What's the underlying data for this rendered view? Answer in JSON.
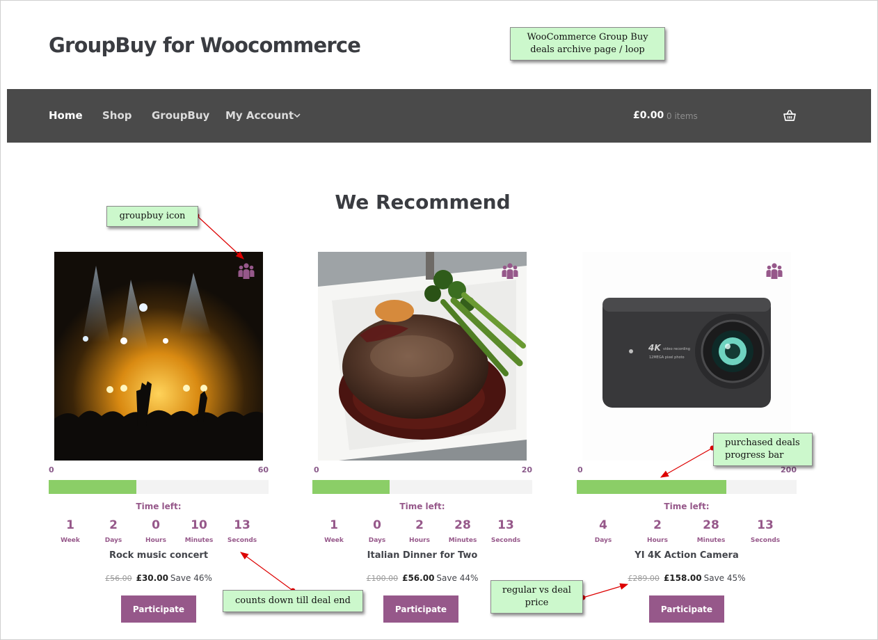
{
  "site": {
    "title": "GroupBuy for Woocommerce"
  },
  "nav": {
    "items": [
      {
        "label": "Home"
      },
      {
        "label": "Shop"
      },
      {
        "label": "GroupBuy"
      },
      {
        "label": "My Account"
      }
    ],
    "cart_total": "£0.00",
    "cart_count": "0 items"
  },
  "section_title": "We Recommend",
  "time_left_label": "Time left:",
  "participate_label": "Participate",
  "products": [
    {
      "title": "Rock music concert",
      "progress_min": "0",
      "progress_max": "60",
      "progress_fraction": 0.4,
      "countdown": [
        {
          "value": "1",
          "label": "Week"
        },
        {
          "value": "2",
          "label": "Days"
        },
        {
          "value": "0",
          "label": "Hours"
        },
        {
          "value": "10",
          "label": "Minutes"
        },
        {
          "value": "13",
          "label": "Seconds"
        }
      ],
      "regular_price": "£56.00",
      "deal_price": "£30.00",
      "save_text": "Save 46%"
    },
    {
      "title": "Italian Dinner for Two",
      "progress_min": "0",
      "progress_max": "20",
      "progress_fraction": 0.35,
      "countdown": [
        {
          "value": "1",
          "label": "Week"
        },
        {
          "value": "0",
          "label": "Days"
        },
        {
          "value": "2",
          "label": "Hours"
        },
        {
          "value": "28",
          "label": "Minutes"
        },
        {
          "value": "13",
          "label": "Seconds"
        }
      ],
      "regular_price": "£100.00",
      "deal_price": "£56.00",
      "save_text": "Save 44%"
    },
    {
      "title": "YI 4K Action Camera",
      "progress_min": "0",
      "progress_max": "200",
      "progress_fraction": 0.68,
      "countdown": [
        {
          "value": "4",
          "label": "Days"
        },
        {
          "value": "2",
          "label": "Hours"
        },
        {
          "value": "28",
          "label": "Minutes"
        },
        {
          "value": "13",
          "label": "Seconds"
        }
      ],
      "regular_price": "£289.00",
      "deal_price": "£158.00",
      "save_text": "Save 45%",
      "camera_text_1": "4K",
      "camera_text_2": "video recording",
      "camera_text_3": "12MEGA pixel photo"
    }
  ],
  "annotations": {
    "archive_line1": "WooCommerce Group Buy",
    "archive_line2": "deals archive page / loop",
    "icon": "groupbuy icon",
    "progress_line1": "purchased deals",
    "progress_line2": "progress bar",
    "countdown": "counts down till deal end",
    "price_line1": "regular vs deal",
    "price_line2": "price"
  },
  "colors": {
    "accent": "#96588a",
    "nav_bg": "#4a4a4a",
    "progress_fill": "#8bce67",
    "note_bg": "#ccf8cc",
    "arrow": "#dd0000"
  },
  "icons": [
    "groupbuy-icon",
    "chevron-down-icon",
    "basket-icon"
  ]
}
